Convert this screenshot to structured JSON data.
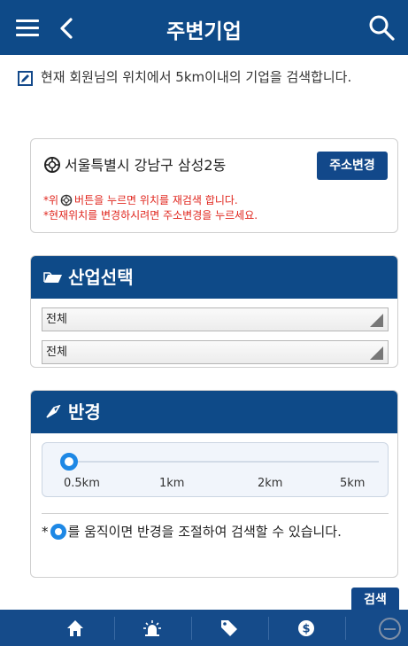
{
  "header": {
    "title": "주변기업",
    "icons": [
      "menu-icon",
      "back-icon",
      "search-icon"
    ]
  },
  "info_text": "현재 회원님의 위치에서 5km이내의 기업을 검색합니다.",
  "location": {
    "address": "서울특별시 강남구 삼성2동",
    "change_button": "주소변경",
    "note_prefix": "*위",
    "note_suffix": "버튼을 누르면 위치를 재검색 합니다.",
    "note2": "*현재위치를 변경하시려면 주소변경을 누르세요."
  },
  "industry": {
    "title": "산업선택",
    "select1": "전체",
    "select2": "전체"
  },
  "radius": {
    "title": "반경",
    "ticks": [
      "0.5km",
      "1km",
      "2km",
      "5km"
    ],
    "selected": "0.5km",
    "note_prefix": "*",
    "note_suffix": "를 움직이면 반경을 조절하여 검색할 수 있습니다."
  },
  "search_button": "검색",
  "bottom_nav": [
    "home-icon",
    "alarm-icon",
    "tag-icon",
    "dollar-icon"
  ],
  "colors": {
    "primary": "#0e4a88",
    "accent": "#1e88e5",
    "warning": "#e0261e"
  }
}
